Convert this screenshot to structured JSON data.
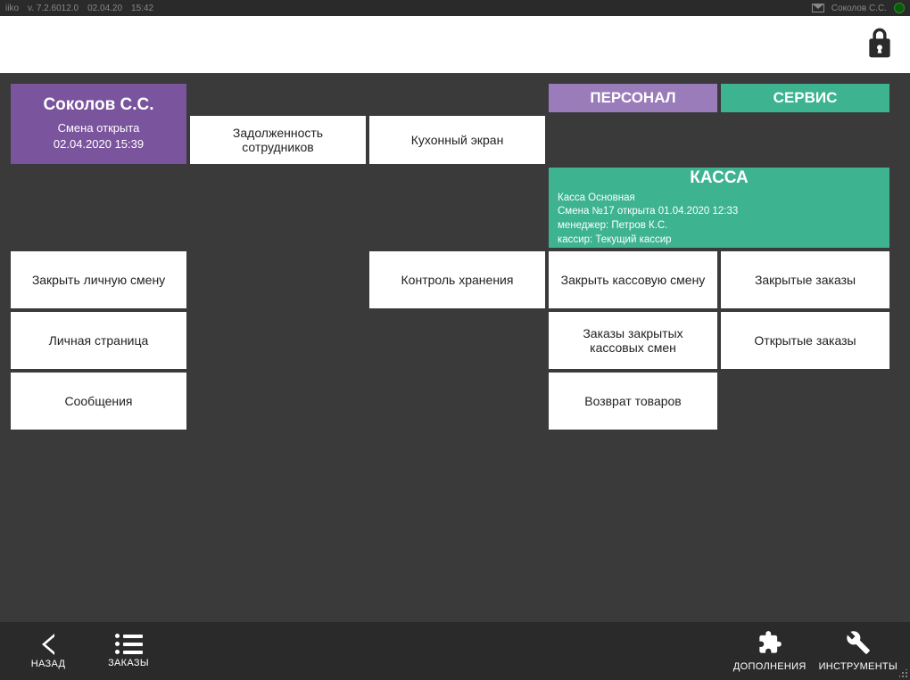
{
  "titlebar": {
    "app": "iiko",
    "version": "v. 7.2.6012.0",
    "date": "02.04.20",
    "time": "15:42",
    "user": "Соколов С.С."
  },
  "user_col": {
    "name": "Соколов С.С.",
    "shift_status": "Смена открыта",
    "shift_opened": "02.04.2020 15:39",
    "btn_close_personal": "Закрыть личную смену",
    "btn_personal_page": "Личная страница",
    "btn_messages": "Сообщения"
  },
  "personnel_col": {
    "title": "ПЕРСОНАЛ",
    "btn_debt": "Задолженность сотрудников"
  },
  "service_col": {
    "title": "СЕРВИС",
    "btn_kitchen": "Кухонный экран",
    "btn_storage": "Контроль хранения"
  },
  "kassa": {
    "title": "КАССА",
    "info1": "Касса Основная",
    "info2": "Смена №17 открыта 01.04.2020 12:33",
    "info3": "менеджер: Петров К.С.",
    "info4": "кассир: Текущий кассир",
    "btn_close_shift": "Закрыть кассовую смену",
    "btn_closed_orders": "Закрытые заказы",
    "btn_closed_shift_orders": "Заказы закрытых кассовых смен",
    "btn_open_orders": "Открытые заказы",
    "btn_return": "Возврат товаров"
  },
  "bottom": {
    "back": "НАЗАД",
    "orders": "ЗАКАЗЫ",
    "addons": "ДОПОЛНЕНИЯ",
    "tools": "ИНСТРУМЕНТЫ"
  }
}
